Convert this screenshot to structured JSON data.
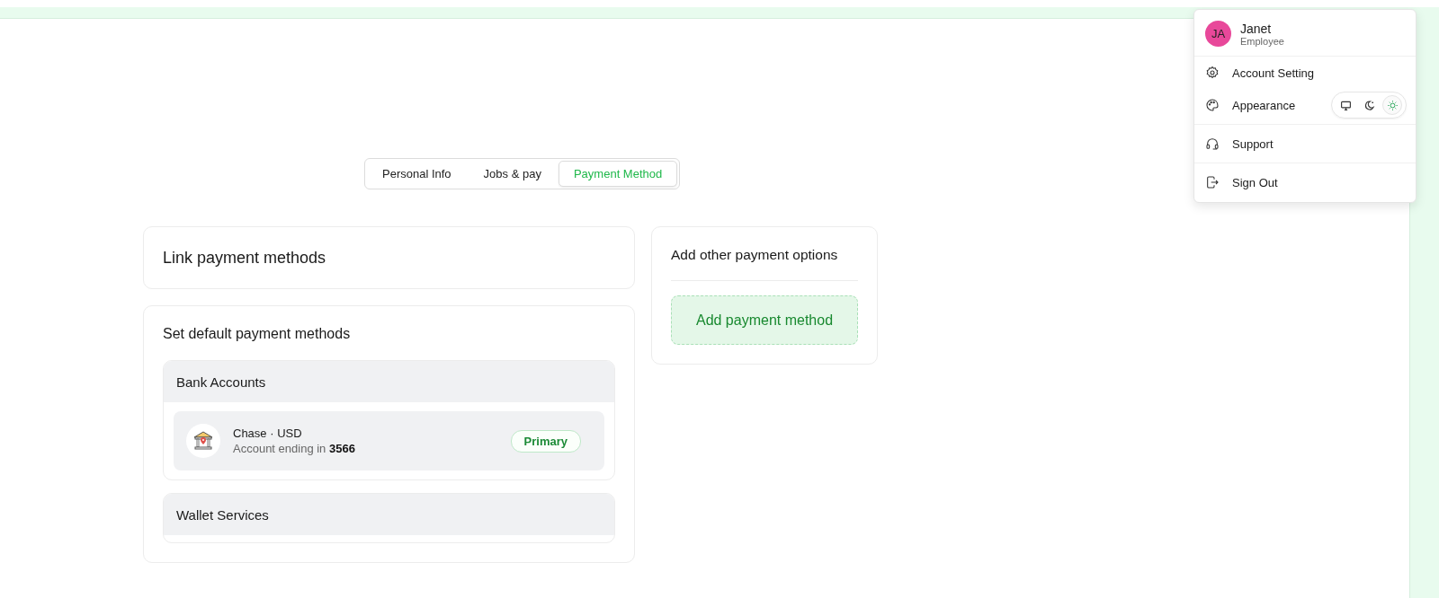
{
  "tabs": [
    {
      "label": "Personal Info",
      "selected": false
    },
    {
      "label": "Jobs & pay",
      "selected": false
    },
    {
      "label": "Payment Method",
      "selected": true
    }
  ],
  "link_card": {
    "title": "Link payment methods"
  },
  "default_card": {
    "title": "Set default payment methods",
    "groups": [
      {
        "title": "Bank Accounts",
        "accounts": [
          {
            "name": "Chase · USD",
            "detail": "Account ending in **3566**",
            "badge": "Primary"
          }
        ]
      },
      {
        "title": "Wallet Services"
      }
    ]
  },
  "other_card": {
    "title": "Add other payment options",
    "button": "Add payment method"
  },
  "user_menu": {
    "user": {
      "initials": "JA",
      "name": "Janet",
      "role": "Employee"
    },
    "items": [
      {
        "kind": "settings",
        "label": "Account Setting"
      },
      {
        "kind": "appearance",
        "label": "Appearance",
        "themes": [
          {
            "kind": "monitor",
            "selected": false
          },
          {
            "kind": "moon",
            "selected": false
          },
          {
            "kind": "sun",
            "selected": true
          }
        ]
      },
      {
        "kind": "support",
        "label": "Support"
      },
      {
        "kind": "signout",
        "label": "Sign Out"
      }
    ]
  }
}
